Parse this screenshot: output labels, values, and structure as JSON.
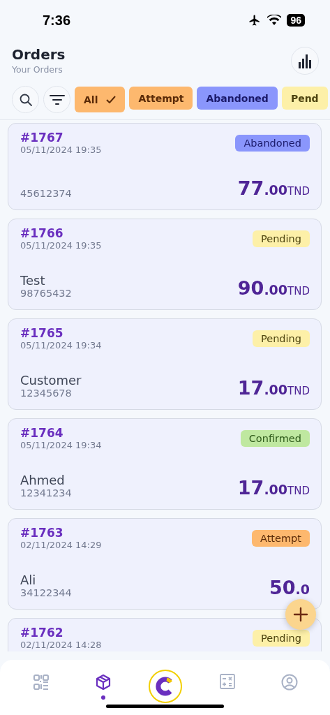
{
  "status_bar": {
    "time": "7:36",
    "battery": "96"
  },
  "header": {
    "title": "Orders",
    "subtitle": "Your Orders"
  },
  "filters": [
    {
      "label": "All",
      "selected": true,
      "color": "#fdb86e"
    },
    {
      "label": "Attempt",
      "selected": false,
      "color": "#fdb86e"
    },
    {
      "label": "Abandoned",
      "selected": false,
      "color": "#8a96fc"
    },
    {
      "label": "Pend",
      "selected": false,
      "color": "#fdf0a8"
    }
  ],
  "orders": [
    {
      "number": "#1767",
      "date": "05/11/2024 19:35",
      "status": "Abandoned",
      "color": "#8a96fc",
      "phone": "45612374",
      "amount": "77",
      "decimals": ".00",
      "currency": "TND"
    },
    {
      "number": "#1766",
      "date": "05/11/2024 19:35",
      "status": "Pending",
      "color": "#fdf0a8",
      "name": "Test",
      "phone": "98765432",
      "amount": "90",
      "decimals": ".00",
      "currency": "TND"
    },
    {
      "number": "#1765",
      "date": "05/11/2024 19:34",
      "status": "Pending",
      "color": "#fdf0a8",
      "name": "Customer",
      "phone": "12345678",
      "amount": "17",
      "decimals": ".00",
      "currency": "TND"
    },
    {
      "number": "#1764",
      "date": "05/11/2024 19:34",
      "status": "Confirmed",
      "color": "#bfe8a0",
      "name": "Ahmed",
      "phone": "12341234",
      "amount": "17",
      "decimals": ".00",
      "currency": "TND"
    },
    {
      "number": "#1763",
      "date": "02/11/2024 14:29",
      "status": "Attempt",
      "color": "#fdb86e",
      "name": "Ali",
      "phone": "34122344",
      "amount": "50",
      "decimals": ".0"
    },
    {
      "number": "#1762",
      "date": "02/11/2024 14:28",
      "status": "Pending",
      "color": "#fdf0a8"
    }
  ],
  "nav": [
    {
      "kind": "qr",
      "selected": false
    },
    {
      "kind": "box",
      "selected": true
    },
    {
      "kind": "logo",
      "selected": false
    },
    {
      "kind": "calculator",
      "selected": false
    },
    {
      "kind": "profile",
      "selected": false
    }
  ]
}
